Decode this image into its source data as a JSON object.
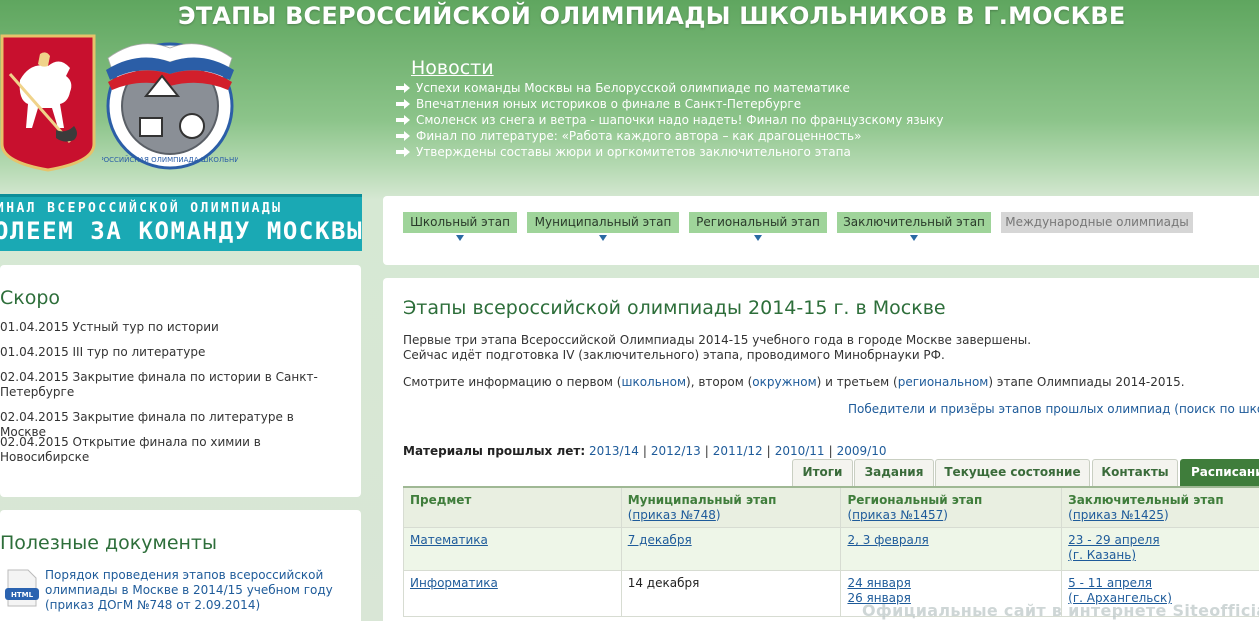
{
  "header": {
    "title": "ЭТАПЫ ВСЕРОССИЙСКОЙ ОЛИМПИАДЫ ШКОЛЬНИКОВ В Г.МОСКВЕ",
    "olymp_logo_text": "ВСЕРОССИЙСКАЯ ОЛИМПИАДА ШКОЛЬНИКОВ"
  },
  "news": {
    "heading": "Новости",
    "items": [
      "Успехи команды Москвы на Белорусской олимпиаде по математике",
      "Впечатления юных историков о финале в Санкт-Петербурге",
      "Смоленск из снега и ветра - шапочки надо надеть! Финал по французскому языку",
      "Финал по литературе: «Работа каждого автора – как драгоценность»",
      "Утверждены составы жюри и оргкомитетов заключительного этапа"
    ]
  },
  "banner": {
    "line1": "ИНАЛ ВСЕРОССИЙСКОЙ ОЛИМПИАДЫ",
    "line2": "ОЛЕЕМ ЗА КОМАНДУ МОСКВЫ"
  },
  "soon": {
    "title": "Скоро",
    "items": [
      "01.04.2015 Устный тур по истории",
      "01.04.2015 III тур по литературе",
      "02.04.2015 Закрытие финала по истории в Санкт-Петербурге",
      "02.04.2015 Закрытие финала по литературе в Москве",
      "02.04.2015 Открытие финала по химии в Новосибирске"
    ]
  },
  "docs": {
    "title": "Полезные документы",
    "icon_label": "HTML",
    "item": "Порядок проведения этапов всероссийской олимпиады в Москве в 2014/15 учебном году (приказ ДОгМ №748 от 2.09.2014)"
  },
  "stage_tabs": [
    "Школьный этап",
    "Муниципальный этап",
    "Региональный этап",
    "Заключительный этап",
    "Международные олимпиады"
  ],
  "main": {
    "title": "Этапы всероссийской олимпиады 2014-15 г. в Москве",
    "intro_line1": "Первые три этапа Всероссийской  Олимпиады 2014-15 учебного года в городе Москве завершены.",
    "intro_line2": "Сейчас идёт подготовка IV (заключительного) этапа, проводимого Минобрнауки РФ.",
    "see_prefix": "Смотрите информацию о первом (",
    "see_link1": "школьном",
    "see_mid1": "),  втором (",
    "see_link2": "окружном",
    "see_mid2": ") и третьем (",
    "see_link3": "региональном",
    "see_suffix": ") этапе Олимпиады 2014-2015.",
    "winners_link": "Победители и призёры",
    "winners_rest": " этапов  прошлых олимпиад (поиск по школ",
    "past_label": "Материалы прошлых лет:",
    "past_years": [
      "2013/14",
      "2012/13",
      "2011/12",
      "2010/11",
      "2009/10"
    ]
  },
  "content_tabs": [
    "Итоги",
    "Задания",
    "Текущее состояние",
    "Контакты",
    "Расписани"
  ],
  "table": {
    "headers": [
      {
        "title": "Предмет",
        "sub": ""
      },
      {
        "title": "Муниципальный этап",
        "sub_prefix": "(",
        "sub_link": "приказ №748",
        "sub_suffix": ")"
      },
      {
        "title": "Региональный этап",
        "sub_prefix": "(",
        "sub_link": "приказ №1457",
        "sub_suffix": ")"
      },
      {
        "title": "Заключительный этап",
        "sub_prefix": "(",
        "sub_link": "приказ №1425",
        "sub_suffix": ")"
      }
    ],
    "rows": [
      {
        "subject": "Математика",
        "municipal": "7 декабря",
        "regional_1": "2, 3 февраля",
        "regional_2": "",
        "final_1": "23 - 29 апреля",
        "final_2": "(г. Казань)"
      },
      {
        "subject": "Информатика",
        "municipal": "14 декабря",
        "regional_1": "24 января",
        "regional_2": "26 января",
        "final_1": "5 - 11 апреля",
        "final_2": "(г. Архангельск)"
      }
    ]
  },
  "watermark": "Официальные сайт в интернете Siteofficial.ru",
  "colors": {
    "header_green": "#5fa65f",
    "tab_green": "#9fd49a",
    "heading_green": "#2d6e3a",
    "link_blue": "#1e5b9a",
    "banner_teal": "#1aa9b4",
    "active_tab": "#3f7d3b"
  }
}
